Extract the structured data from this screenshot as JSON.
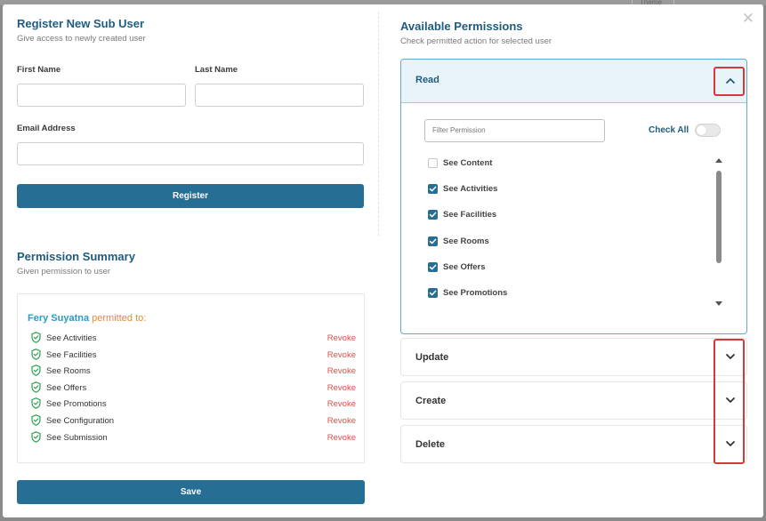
{
  "background": {
    "tag": "Theme"
  },
  "register": {
    "title": "Register New Sub User",
    "subtitle": "Give access to newly created user",
    "first_name_label": "First Name",
    "last_name_label": "Last Name",
    "email_label": "Email Address",
    "first_name_value": "",
    "last_name_value": "",
    "email_value": "",
    "register_button": "Register"
  },
  "summary": {
    "title": "Permission Summary",
    "subtitle": "Given permission to user",
    "user_name": "Fery Suyatna",
    "permitted_text": "permitted to:",
    "revoke_label": "Revoke",
    "items": [
      "See Activities",
      "See Facilities",
      "See Rooms",
      "See Offers",
      "See Promotions",
      "See Configuration",
      "See Submission"
    ],
    "save_button": "Save"
  },
  "permissions": {
    "title": "Available Permissions",
    "subtitle": "Check permitted action for selected user",
    "filter_placeholder": "Filter Permission",
    "check_all_label": "Check All",
    "check_all_on": false,
    "panels": [
      {
        "label": "Read",
        "expanded": true
      },
      {
        "label": "Update",
        "expanded": false
      },
      {
        "label": "Create",
        "expanded": false
      },
      {
        "label": "Delete",
        "expanded": false
      }
    ],
    "read_items": [
      {
        "label": "See Content",
        "checked": false
      },
      {
        "label": "See Activities",
        "checked": true
      },
      {
        "label": "See Facilities",
        "checked": true
      },
      {
        "label": "See Rooms",
        "checked": true
      },
      {
        "label": "See Offers",
        "checked": true
      },
      {
        "label": "See Promotions",
        "checked": true
      }
    ]
  },
  "colors": {
    "primary": "#266e94",
    "title": "#1f5c7f",
    "user_name": "#2a9bc4",
    "permitted": "#e58a2f",
    "revoke": "#e05046",
    "shield": "#2e9e4f",
    "highlight": "#d33b3b"
  },
  "icons": {
    "close": "close-icon",
    "chevron_up": "chevron-up-icon",
    "chevron_down": "chevron-down-icon",
    "shield": "shield-check-icon"
  }
}
